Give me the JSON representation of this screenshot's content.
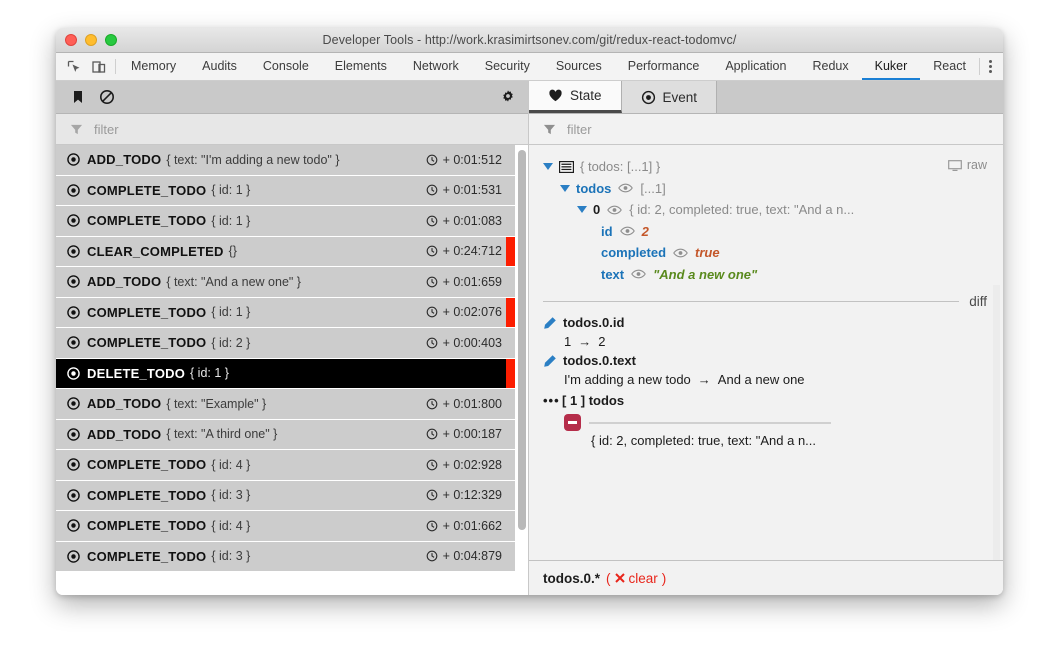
{
  "window": {
    "title": "Developer Tools - http://work.krasimirtsonev.com/git/redux-react-todomvc/",
    "traffic_lights": [
      "close",
      "minimize",
      "zoom"
    ]
  },
  "devtools": {
    "icons": [
      "inspect-element-icon",
      "device-toolbar-icon"
    ],
    "tabs": [
      {
        "label": "Memory",
        "active": false
      },
      {
        "label": "Audits",
        "active": false
      },
      {
        "label": "Console",
        "active": false
      },
      {
        "label": "Elements",
        "active": false
      },
      {
        "label": "Network",
        "active": false
      },
      {
        "label": "Security",
        "active": false
      },
      {
        "label": "Sources",
        "active": false
      },
      {
        "label": "Performance",
        "active": false
      },
      {
        "label": "Application",
        "active": false
      },
      {
        "label": "Redux",
        "active": false
      },
      {
        "label": "Kuker",
        "active": true
      },
      {
        "label": "React",
        "active": false
      }
    ],
    "more_menu": "kebab-menu-icon",
    "accent_color": "#1a7fd4"
  },
  "left_panel": {
    "toolbar": {
      "bookmark_icon": "bookmark-icon",
      "clear_icon": "ban-icon",
      "settings_icon": "gear-icon"
    },
    "filter": {
      "placeholder": "filter",
      "value": "",
      "icon": "funnel-icon"
    },
    "rows": [
      {
        "type": "ADD_TODO",
        "payload": "{ text: \"I'm adding a new todo\" }",
        "time": "+ 0:01:512",
        "selected": false,
        "marked": false
      },
      {
        "type": "COMPLETE_TODO",
        "payload": "{ id: 1 }",
        "time": "+ 0:01:531",
        "selected": false,
        "marked": false
      },
      {
        "type": "COMPLETE_TODO",
        "payload": "{ id: 1 }",
        "time": "+ 0:01:083",
        "selected": false,
        "marked": false
      },
      {
        "type": "CLEAR_COMPLETED",
        "payload": "{}",
        "time": "+ 0:24:712",
        "selected": false,
        "marked": true
      },
      {
        "type": "ADD_TODO",
        "payload": "{ text: \"And a new one\" }",
        "time": "+ 0:01:659",
        "selected": false,
        "marked": false
      },
      {
        "type": "COMPLETE_TODO",
        "payload": "{ id: 1 }",
        "time": "+ 0:02:076",
        "selected": false,
        "marked": true
      },
      {
        "type": "COMPLETE_TODO",
        "payload": "{ id: 2 }",
        "time": "+ 0:00:403",
        "selected": false,
        "marked": false
      },
      {
        "type": "DELETE_TODO",
        "payload": "{ id: 1 }",
        "time": "",
        "selected": true,
        "marked": true
      },
      {
        "type": "ADD_TODO",
        "payload": "{ text: \"Example\" }",
        "time": "+ 0:01:800",
        "selected": false,
        "marked": false
      },
      {
        "type": "ADD_TODO",
        "payload": "{ text: \"A third one\" }",
        "time": "+ 0:00:187",
        "selected": false,
        "marked": false
      },
      {
        "type": "COMPLETE_TODO",
        "payload": "{ id: 4 }",
        "time": "+ 0:02:928",
        "selected": false,
        "marked": false
      },
      {
        "type": "COMPLETE_TODO",
        "payload": "{ id: 3 }",
        "time": "+ 0:12:329",
        "selected": false,
        "marked": false
      },
      {
        "type": "COMPLETE_TODO",
        "payload": "{ id: 4 }",
        "time": "+ 0:01:662",
        "selected": false,
        "marked": false
      },
      {
        "type": "COMPLETE_TODO",
        "payload": "{ id: 3 }",
        "time": "+ 0:04:879",
        "selected": false,
        "marked": false
      }
    ],
    "marker_color": "#fc1d00"
  },
  "right_panel": {
    "tabs": [
      {
        "label": "State",
        "icon": "heart-icon",
        "active": true
      },
      {
        "label": "Event",
        "icon": "target-icon",
        "active": false
      }
    ],
    "filter": {
      "placeholder": "filter",
      "value": "",
      "icon": "funnel-icon"
    },
    "raw_toggle": {
      "label": "raw",
      "icon": "monitor-icon"
    },
    "tree": {
      "root": {
        "summary": "{ todos: [...1] }",
        "icon": "object-icon"
      },
      "todos": {
        "key": "todos",
        "summary": "[...1]"
      },
      "item0": {
        "key": "0",
        "summary": "{ id: 2, completed: true, text: \"And a n..."
      },
      "fields": [
        {
          "key": "id",
          "value": "2",
          "kind": "number"
        },
        {
          "key": "completed",
          "value": "true",
          "kind": "boolean"
        },
        {
          "key": "text",
          "value": "\"And a new one\"",
          "kind": "string"
        }
      ]
    },
    "diff": {
      "label": "diff",
      "changes": [
        {
          "path": "todos.0.id",
          "from": "1",
          "to": "2",
          "icon": "pencil-icon"
        },
        {
          "path": "todos.0.text",
          "from": "I'm adding a new todo",
          "to": "And a new one",
          "icon": "pencil-icon"
        }
      ],
      "arrow": "→",
      "removed": {
        "header": "[ 1 ] todos",
        "header_icon": "ellipsis-icon",
        "badge": "minus-badge",
        "value": "{ id: 2, completed: true, text: \"And a n..."
      }
    },
    "path_bar": {
      "path": "todos.0.*",
      "clear_label": "clear",
      "clear_icon": "x-icon",
      "clear_color": "#e8251b"
    }
  }
}
